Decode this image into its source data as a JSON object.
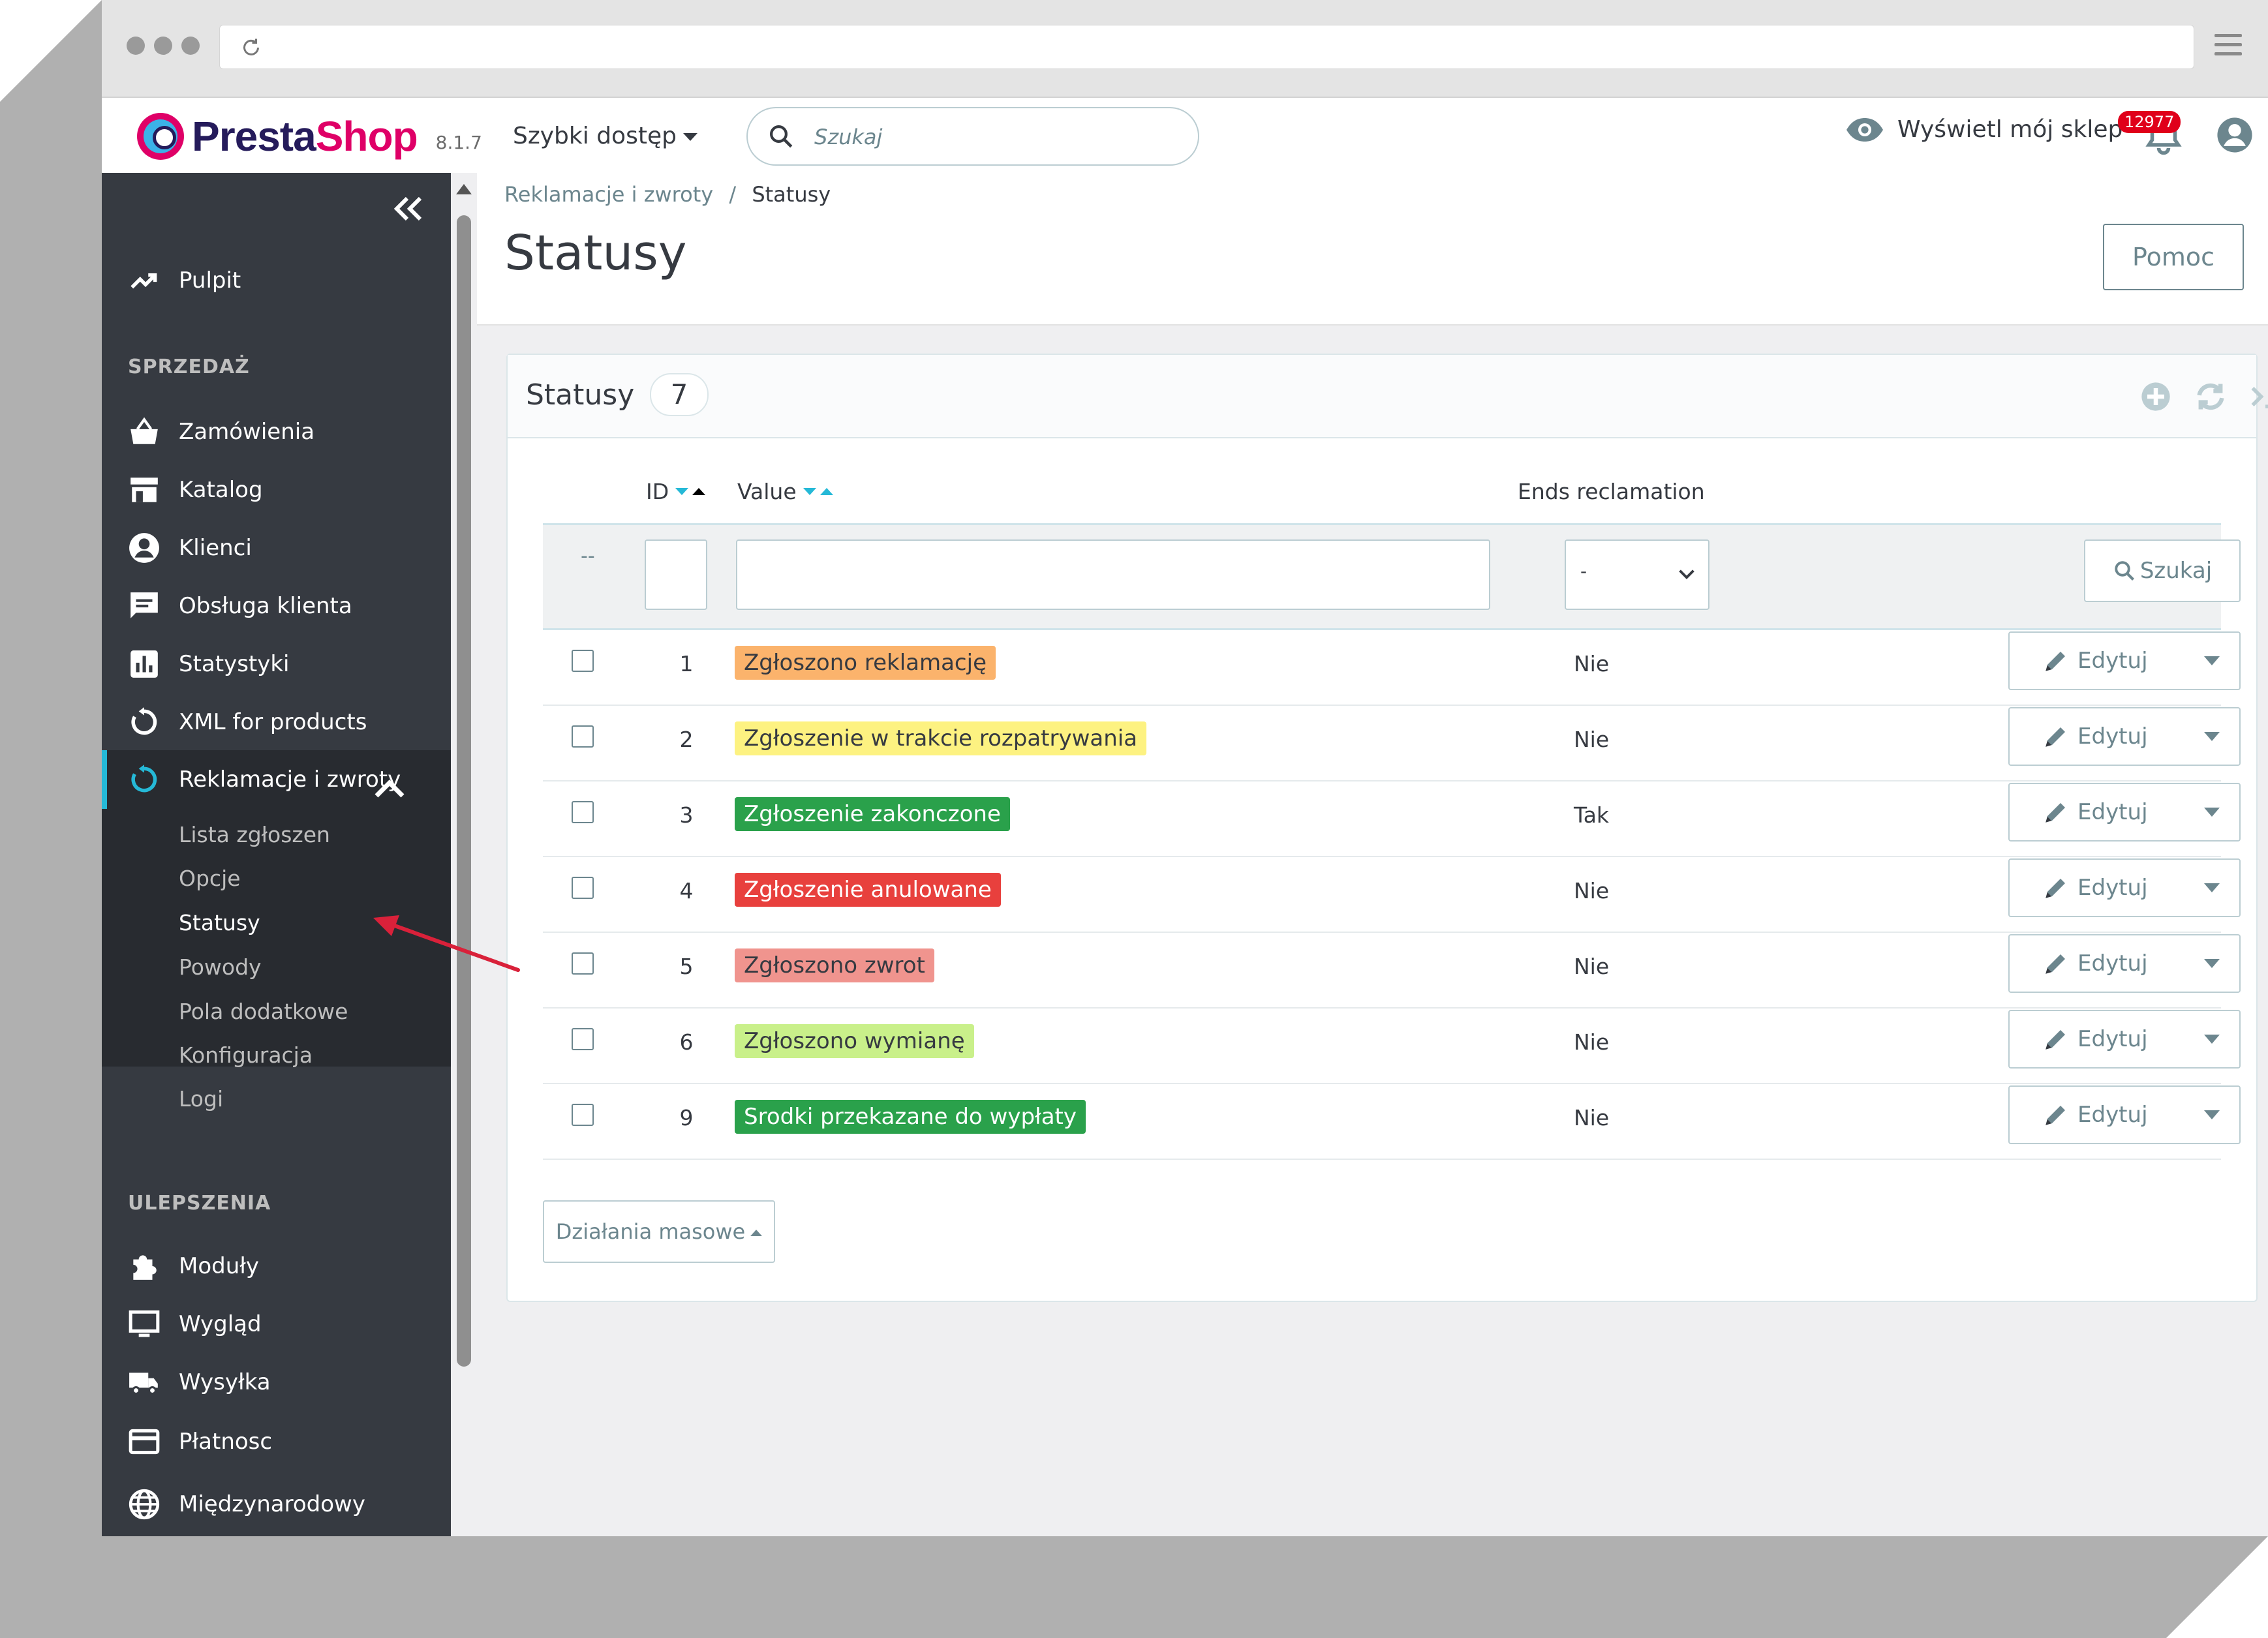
{
  "header": {
    "brand_presta": "Presta",
    "brand_shop": "Shop",
    "version": "8.1.7",
    "quick_access": "Szybki dostęp",
    "search_placeholder": "Szukaj",
    "view_shop": "Wyświetl mój sklep",
    "notification_count": "12977"
  },
  "sidebar": {
    "dashboard": "Pulpit",
    "section_sales": "SPRZEDAŻ",
    "sales_items": [
      "Zamówienia",
      "Katalog",
      "Klienci",
      "Obsługa klienta",
      "Statystyki",
      "XML for products"
    ],
    "active_item": "Reklamacje i zwroty",
    "sub_items": [
      "Lista zgłoszen",
      "Opcje",
      "Statusy",
      "Powody",
      "Pola dodatkowe",
      "Konfiguracja",
      "Logi"
    ],
    "section_improvements": "ULEPSZENIA",
    "improvement_items": [
      "Moduły",
      "Wygląd",
      "Wysyłka",
      "Płatnosc",
      "Międzynarodowy"
    ]
  },
  "page": {
    "breadcrumb_parent": "Reklamacje i zwroty",
    "breadcrumb_sep": "/",
    "breadcrumb_current": "Statusy",
    "title": "Statusy",
    "help": "Pomoc"
  },
  "panel": {
    "title": "Statusy",
    "count": "7",
    "columns": {
      "id": "ID",
      "value": "Value",
      "ends": "Ends reclamation"
    },
    "filter_dash": "--",
    "filter_select": "-",
    "search_button": "Szukaj",
    "rows": [
      {
        "id": "1",
        "value": "Zgłoszono reklamację",
        "ends": "Nie",
        "bg": "#fbb36c",
        "fg": "#363a41"
      },
      {
        "id": "2",
        "value": "Zgłoszenie w trakcie rozpatrywania",
        "ends": "Nie",
        "bg": "#fdf281",
        "fg": "#363a41"
      },
      {
        "id": "3",
        "value": "Zgłoszenie zakonczone",
        "ends": "Tak",
        "bg": "#2aa14b",
        "fg": "#ffffff"
      },
      {
        "id": "4",
        "value": "Zgłoszenie anulowane",
        "ends": "Nie",
        "bg": "#e8403d",
        "fg": "#ffffff"
      },
      {
        "id": "5",
        "value": "Zgłoszono zwrot",
        "ends": "Nie",
        "bg": "#f0948e",
        "fg": "#363a41"
      },
      {
        "id": "6",
        "value": "Zgłoszono wymianę",
        "ends": "Nie",
        "bg": "#c9f08a",
        "fg": "#363a41"
      },
      {
        "id": "9",
        "value": "Srodki przekazane do wypłaty",
        "ends": "Nie",
        "bg": "#2aa14b",
        "fg": "#ffffff"
      }
    ],
    "edit_label": "Edytuj",
    "bulk_actions": "Działania masowe"
  },
  "colors": {
    "accent": "#25b9d7",
    "sidebar": "#363a41",
    "brand": "#df0067",
    "annotation_arrow": "#d9213a"
  }
}
